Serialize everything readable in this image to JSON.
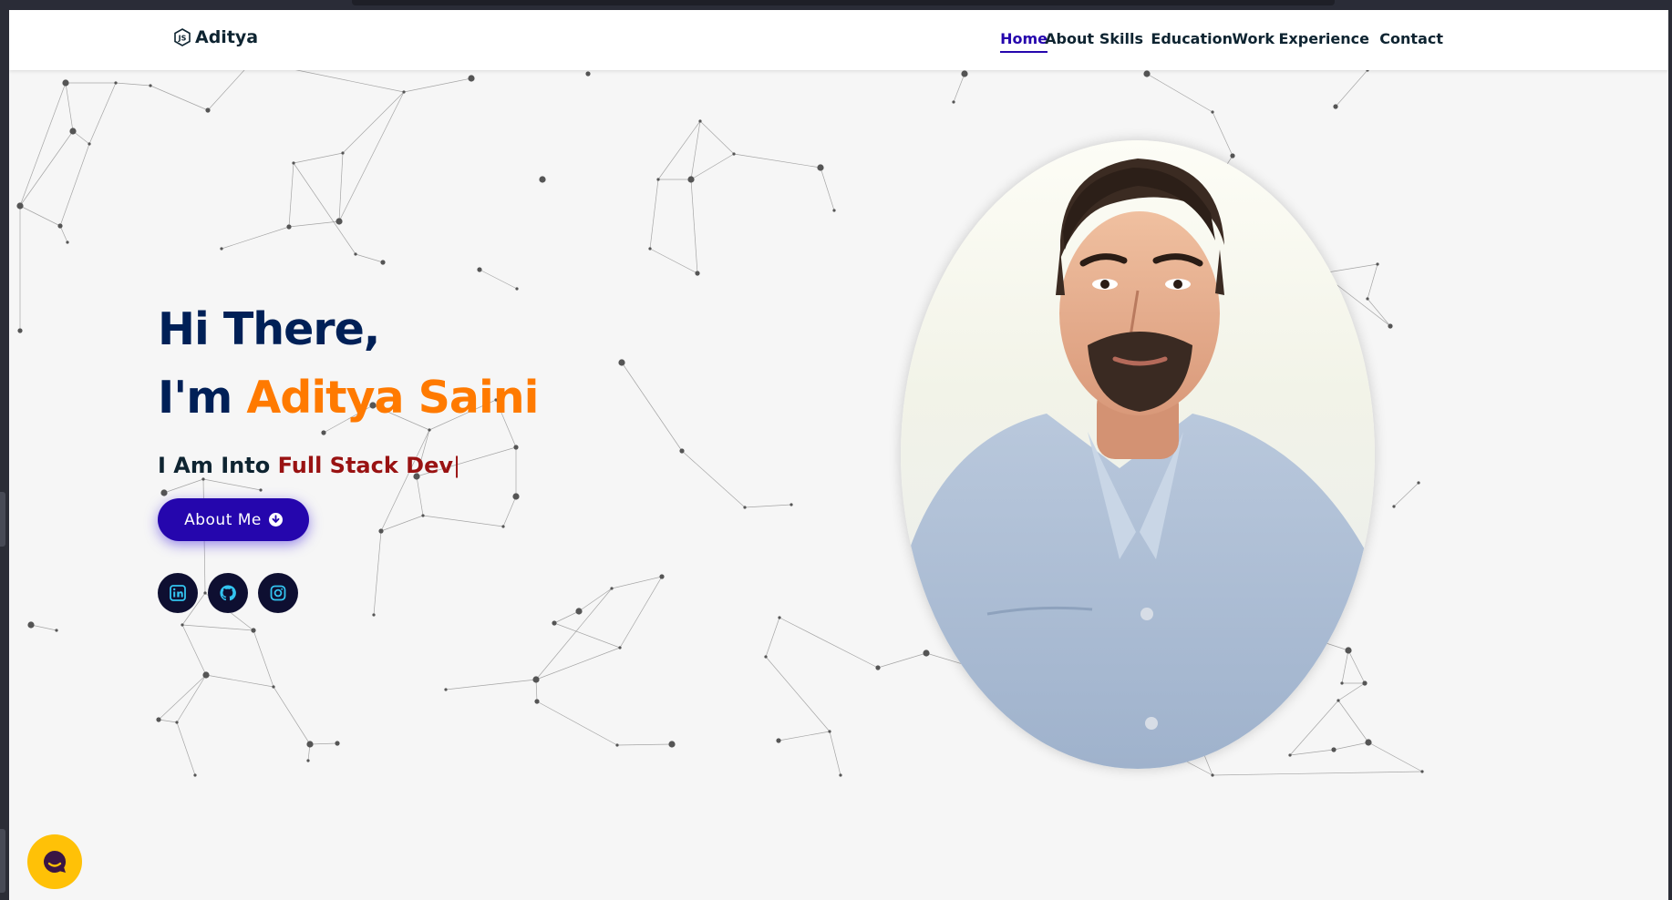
{
  "nav": {
    "logo_text": "Aditya",
    "items": [
      {
        "label": "Home",
        "active": true
      },
      {
        "label": "About",
        "active": false
      },
      {
        "label": "Skills",
        "active": false
      },
      {
        "label": "Education",
        "active": false
      },
      {
        "label": "Work",
        "active": false
      },
      {
        "label": "Experience",
        "active": false
      },
      {
        "label": "Contact",
        "active": false
      }
    ]
  },
  "hero": {
    "greeting": "Hi There,",
    "intro_prefix": "I'm ",
    "name": "Aditya Saini",
    "into_prefix": "I Am Into ",
    "role": "Full Stack Dev",
    "cursor": "|",
    "button_label": "About Me",
    "socials": [
      {
        "icon": "linkedin-icon"
      },
      {
        "icon": "github-icon"
      },
      {
        "icon": "instagram-icon"
      }
    ]
  },
  "colors": {
    "accent": "#2506ad",
    "name": "#ff7a00",
    "role": "#991212",
    "heading": "#002057",
    "chat": "#ffc107"
  }
}
